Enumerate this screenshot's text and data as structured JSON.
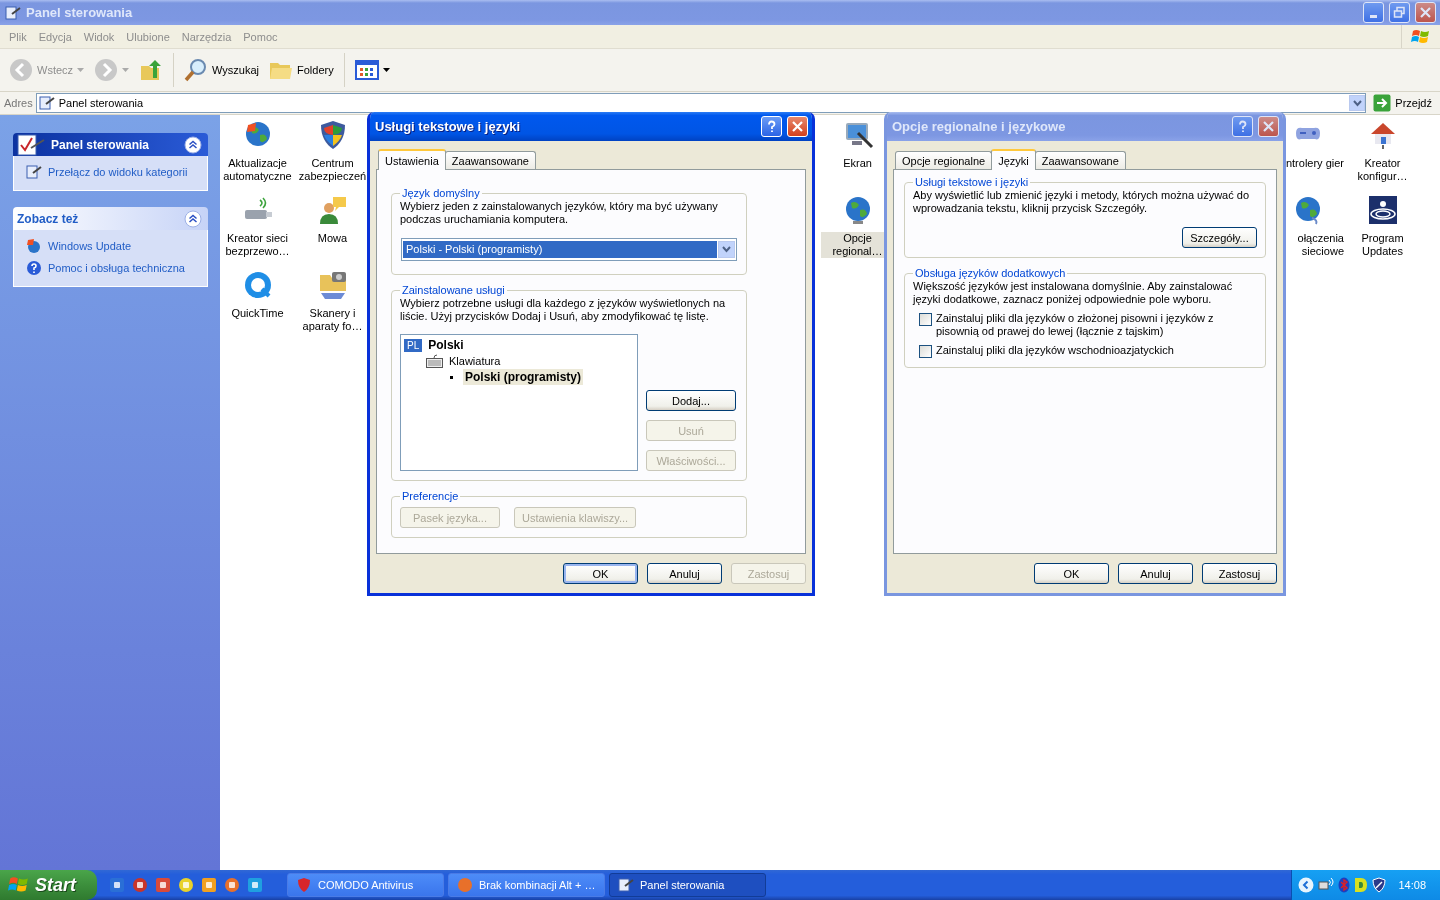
{
  "window": {
    "title": "Panel sterowania",
    "active": false
  },
  "menu": [
    {
      "label": "Plik"
    },
    {
      "label": "Edycja"
    },
    {
      "label": "Widok"
    },
    {
      "label": "Ulubione"
    },
    {
      "label": "Narzędzia"
    },
    {
      "label": "Pomoc"
    }
  ],
  "toolbar": {
    "back": "Wstecz",
    "search": "Wyszukaj",
    "folders": "Foldery"
  },
  "address": {
    "label": "Adres",
    "value": "Panel sterowania",
    "go": "Przejdź"
  },
  "sidebar": [
    {
      "title": "Panel sterowania",
      "kind": "main",
      "expanded": true,
      "items": [
        {
          "label": "Przełącz do widoku kategorii"
        }
      ]
    },
    {
      "title": "Zobacz też",
      "kind": "plain",
      "expanded": true,
      "items": [
        {
          "label": "Windows Update"
        },
        {
          "label": "Pomoc i obsługa techniczna"
        }
      ]
    }
  ],
  "icons": [
    {
      "label": "Aktualizacje automatyczne",
      "selected": false
    },
    {
      "label": "Centrum zabezpieczeń",
      "selected": false
    },
    {
      "label": "Ekran",
      "selected": false
    },
    {
      "label": "ntrolery gier",
      "selected": false
    },
    {
      "label": "Kreator konfigur…",
      "selected": false
    },
    {
      "label": "Kreator sieci bezprzewo…",
      "selected": false
    },
    {
      "label": "Mowa",
      "selected": false
    },
    {
      "label": "Opcje regional…",
      "selected": true
    },
    {
      "label": "ołączenia sieciowe",
      "selected": false
    },
    {
      "label": "Program Updates",
      "selected": false
    },
    {
      "label": "QuickTime",
      "selected": false
    },
    {
      "label": "Skanery i aparaty fo…",
      "selected": false
    }
  ],
  "dialogs": [
    {
      "title": "Usługi tekstowe i języki",
      "active": true,
      "tabs": [
        {
          "label": "Ustawienia",
          "selected": true
        },
        {
          "label": "Zaawansowane",
          "selected": false
        }
      ],
      "groups": [
        {
          "kind": "dropdown",
          "title": "Język domyślny",
          "text": "Wybierz jeden z zainstalowanych języków, który ma być używany podczas uruchamiania komputera.",
          "value": "Polski - Polski (programisty)"
        },
        {
          "kind": "services",
          "title": "Zainstalowane usługi",
          "text": "Wybierz potrzebne usługi dla każdego z języków wyświetlonych na liście. Użyj przycisków Dodaj i Usuń, aby zmodyfikować tę listę.",
          "tree": [
            {
              "badge": "PL",
              "label": "Polski",
              "children": [
                {
                  "label": "Klawiatura",
                  "children": [
                    {
                      "label": "Polski (programisty)",
                      "selected": true
                    }
                  ]
                }
              ]
            }
          ],
          "buttons": [
            {
              "label": "Dodaj...",
              "disabled": false
            },
            {
              "label": "Usuń",
              "disabled": true
            },
            {
              "label": "Właściwości...",
              "disabled": true
            }
          ]
        },
        {
          "kind": "buttons",
          "title": "Preferencje",
          "buttons": [
            {
              "label": "Pasek języka...",
              "disabled": true
            },
            {
              "label": "Ustawienia klawiszy...",
              "disabled": true
            }
          ]
        }
      ],
      "buttons": [
        {
          "label": "OK",
          "disabled": false,
          "focused": true
        },
        {
          "label": "Anuluj",
          "disabled": false,
          "focused": false
        },
        {
          "label": "Zastosuj",
          "disabled": true,
          "focused": false
        }
      ]
    },
    {
      "title": "Opcje regionalne i językowe",
      "active": false,
      "tabs": [
        {
          "label": "Opcje regionalne",
          "selected": false
        },
        {
          "label": "Języki",
          "selected": true
        },
        {
          "label": "Zaawansowane",
          "selected": false
        }
      ],
      "groups": [
        {
          "kind": "text_button",
          "title": "Usługi tekstowe i języki",
          "text": "Aby wyświetlić lub zmienić języki i metody, których można używać do wprowadzania tekstu, kliknij przycisk Szczegóły.",
          "buttons": [
            {
              "label": "Szczegóły...",
              "disabled": false
            }
          ]
        },
        {
          "kind": "checkboxes",
          "title": "Obsługa języków dodatkowych",
          "text": "Większość języków jest instalowana domyślnie. Aby zainstalować języki dodatkowe, zaznacz poniżej odpowiednie pole wyboru.",
          "options": [
            {
              "label": "Zainstaluj pliki dla języków o złożonej pisowni i języków z pisownią od prawej do lewej (łącznie z tajskim)",
              "checked": false
            },
            {
              "label": "Zainstaluj pliki dla języków wschodnioazjatyckich",
              "checked": false
            }
          ]
        }
      ],
      "buttons": [
        {
          "label": "OK",
          "disabled": false,
          "focused": false
        },
        {
          "label": "Anuluj",
          "disabled": false,
          "focused": false
        },
        {
          "label": "Zastosuj",
          "disabled": false,
          "focused": false
        }
      ]
    }
  ],
  "taskbar": {
    "start": "Start",
    "tasks": [
      {
        "label": "COMODO Antivirus",
        "selected": false
      },
      {
        "label": "Brak kombinacji Alt + …",
        "selected": false
      },
      {
        "label": "Panel sterowania",
        "selected": true
      }
    ],
    "clock": "14:08"
  }
}
